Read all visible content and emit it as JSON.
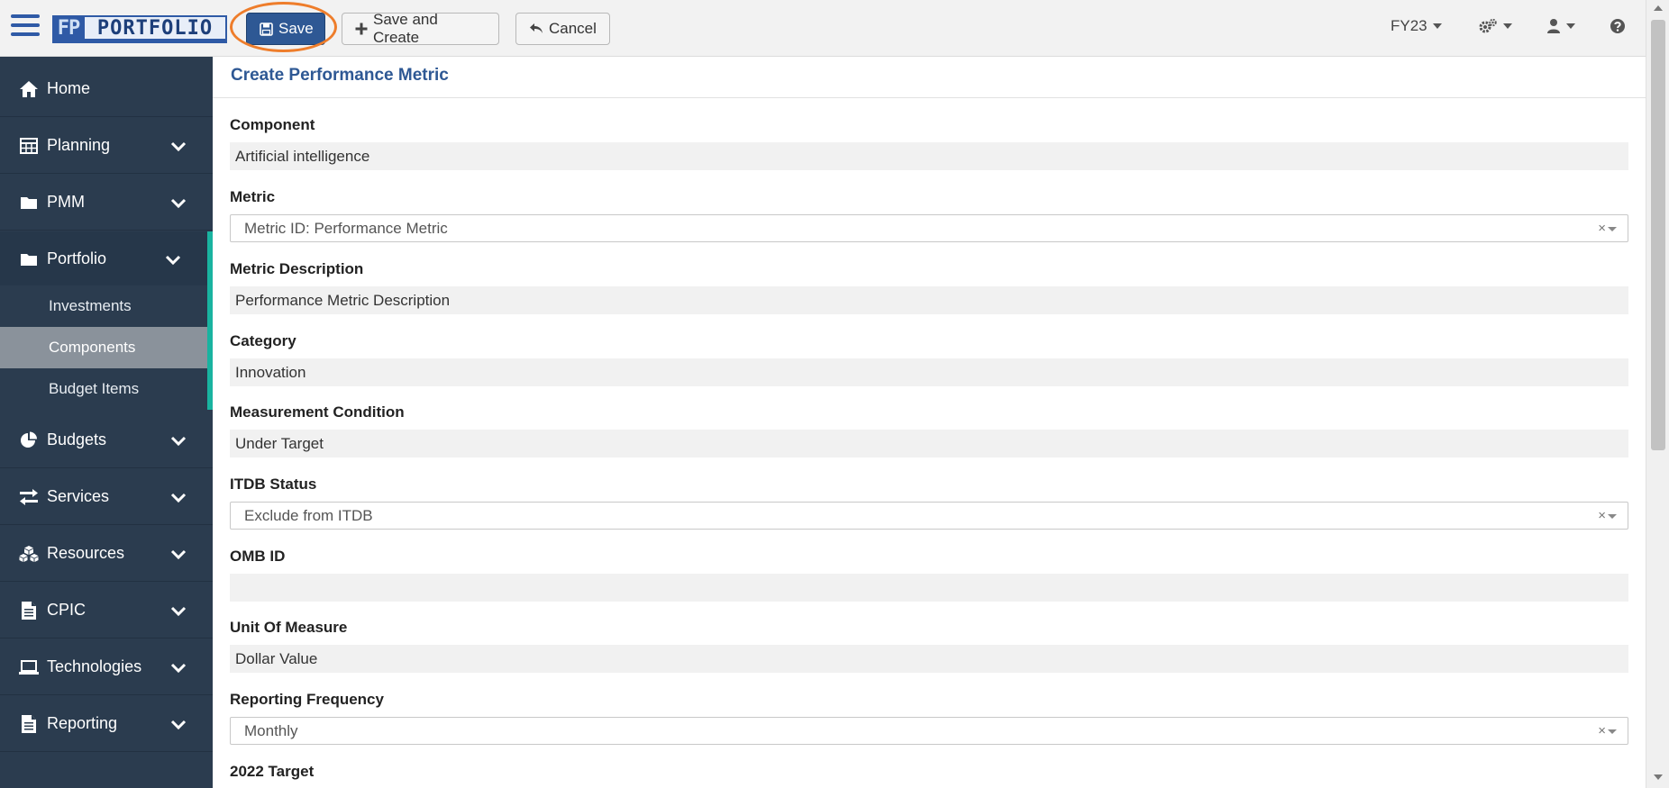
{
  "logo": {
    "fp": "FP",
    "word": "PORTFOLIO"
  },
  "toolbar": {
    "save_label": "Save",
    "save_create_label": "Save and Create",
    "cancel_label": "Cancel"
  },
  "top_right": {
    "fiscal_year": "FY23"
  },
  "sidebar": {
    "items": [
      {
        "label": "Home",
        "icon": "home-icon"
      },
      {
        "label": "Planning",
        "icon": "table-icon"
      },
      {
        "label": "PMM",
        "icon": "folder-icon"
      },
      {
        "label": "Portfolio",
        "icon": "folder-icon"
      },
      {
        "label": "Budgets",
        "icon": "pie-chart-icon"
      },
      {
        "label": "Services",
        "icon": "exchange-icon"
      },
      {
        "label": "Resources",
        "icon": "cubes-icon"
      },
      {
        "label": "CPIC",
        "icon": "document-icon"
      },
      {
        "label": "Technologies",
        "icon": "laptop-icon"
      },
      {
        "label": "Reporting",
        "icon": "document-icon"
      }
    ],
    "portfolio_sub": [
      {
        "label": "Investments"
      },
      {
        "label": "Components"
      },
      {
        "label": "Budget Items"
      }
    ]
  },
  "main": {
    "title": "Create Performance Metric",
    "fields": [
      {
        "label": "Component",
        "value": "Artificial intelligence",
        "kind": "readonly"
      },
      {
        "label": "Metric",
        "value": "Metric ID: Performance Metric",
        "kind": "select"
      },
      {
        "label": "Metric Description",
        "value": "Performance Metric Description",
        "kind": "readonly"
      },
      {
        "label": "Category",
        "value": "Innovation",
        "kind": "readonly"
      },
      {
        "label": "Measurement Condition",
        "value": "Under Target",
        "kind": "readonly"
      },
      {
        "label": "ITDB Status",
        "value": "Exclude from ITDB",
        "kind": "select"
      },
      {
        "label": "OMB ID",
        "value": "",
        "kind": "readonly"
      },
      {
        "label": "Unit Of Measure",
        "value": "Dollar Value",
        "kind": "readonly"
      },
      {
        "label": "Reporting Frequency",
        "value": "Monthly",
        "kind": "select"
      },
      {
        "label": "2022 Target",
        "value": "",
        "kind": "label-only"
      }
    ],
    "select_clear_glyph": "×"
  },
  "colors": {
    "primary": "#2e5894",
    "sidebar_bg": "#2b3c4f",
    "accent_teal": "#19b3a0",
    "highlight_ring": "#ee7d2b",
    "selected_sub": "#8a929b"
  }
}
